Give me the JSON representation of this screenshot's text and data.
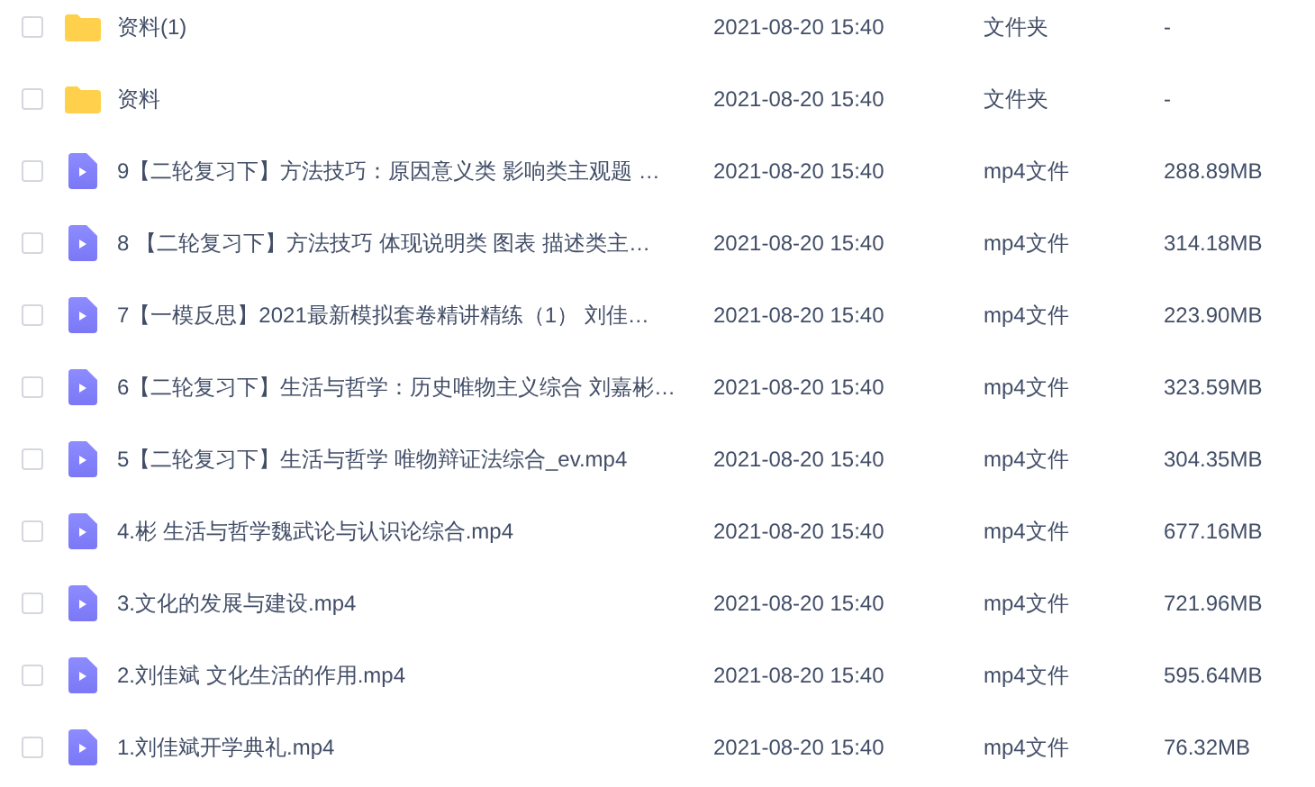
{
  "files": [
    {
      "kind": "folder",
      "checked": false,
      "name": "资料(1)",
      "modified": "2021-08-20 15:40",
      "type": "文件夹",
      "size": "-"
    },
    {
      "kind": "folder",
      "checked": false,
      "name": "资料",
      "modified": "2021-08-20 15:40",
      "type": "文件夹",
      "size": "-"
    },
    {
      "kind": "video",
      "checked": false,
      "name": "9【二轮复习下】方法技巧：原因意义类  影响类主观题   …",
      "modified": "2021-08-20 15:40",
      "type": "mp4文件",
      "size": "288.89MB"
    },
    {
      "kind": "video",
      "checked": false,
      "name": "8 【二轮复习下】方法技巧  体现说明类 图表 描述类主…",
      "modified": "2021-08-20 15:40",
      "type": "mp4文件",
      "size": "314.18MB"
    },
    {
      "kind": "video",
      "checked": false,
      "name": "7【一模反思】2021最新模拟套卷精讲精练（1）  刘佳…",
      "modified": "2021-08-20 15:40",
      "type": "mp4文件",
      "size": "223.90MB"
    },
    {
      "kind": "video",
      "checked": false,
      "name": "6【二轮复习下】生活与哲学：历史唯物主义综合  刘嘉彬…",
      "modified": "2021-08-20 15:40",
      "type": "mp4文件",
      "size": "323.59MB"
    },
    {
      "kind": "video",
      "checked": false,
      "name": "5【二轮复习下】生活与哲学  唯物辩证法综合_ev.mp4",
      "modified": "2021-08-20 15:40",
      "type": "mp4文件",
      "size": "304.35MB"
    },
    {
      "kind": "video",
      "checked": false,
      "name": "4.彬  生活与哲学魏武论与认识论综合.mp4",
      "modified": "2021-08-20 15:40",
      "type": "mp4文件",
      "size": "677.16MB"
    },
    {
      "kind": "video",
      "checked": false,
      "name": "3.文化的发展与建设.mp4",
      "modified": "2021-08-20 15:40",
      "type": "mp4文件",
      "size": "721.96MB"
    },
    {
      "kind": "video",
      "checked": false,
      "name": "2.刘佳斌 文化生活的作用.mp4",
      "modified": "2021-08-20 15:40",
      "type": "mp4文件",
      "size": "595.64MB"
    },
    {
      "kind": "video",
      "checked": false,
      "name": "1.刘佳斌开学典礼.mp4",
      "modified": "2021-08-20 15:40",
      "type": "mp4文件",
      "size": "76.32MB"
    }
  ]
}
